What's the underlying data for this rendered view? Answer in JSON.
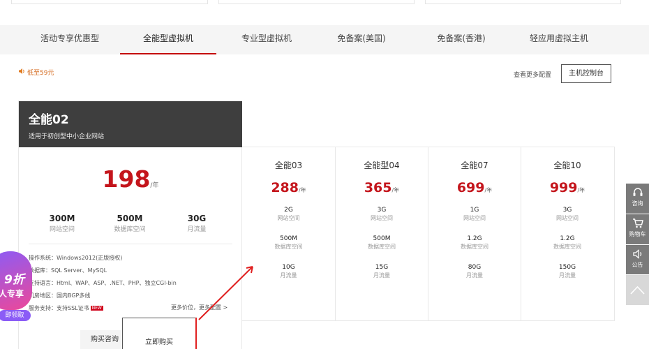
{
  "tabs": [
    {
      "label": "活动专享优惠型"
    },
    {
      "label": "全能型虚拟机"
    },
    {
      "label": "专业型虚拟机"
    },
    {
      "label": "免备案(美国)"
    },
    {
      "label": "免备案(香港)"
    },
    {
      "label": "轻应用虚拟主机"
    }
  ],
  "active_tab": "全能型虚拟机",
  "notice": {
    "text": "低至59元",
    "icon": "speaker-icon"
  },
  "more_config": "查看更多配置",
  "console_button": "主机控制台",
  "featured": {
    "title": "全能02",
    "subtitle": "适用于初创型中小企业网站",
    "price": "198",
    "unit": "/年",
    "specs": [
      {
        "value": "300M",
        "label": "网站空间"
      },
      {
        "value": "500M",
        "label": "数据库空间"
      },
      {
        "value": "30G",
        "label": "月流量"
      }
    ],
    "details": [
      "操作系统：Windows2012(正版授权)",
      "数据库：SQL Server、MySQL",
      "支持语言：Html、WAP、ASP、.NET、PHP、独立CGI-bin",
      "机房地区：国内BGP多线",
      "服务支持：支持SSL证书"
    ],
    "new_badge": "NEW",
    "more_price": "更多价位，更多配置 >",
    "consult_button": "购买咨询",
    "buy_button": "立即购买"
  },
  "plans": [
    {
      "name": "全能03",
      "price": "288",
      "unit": "/年",
      "specs": [
        {
          "value": "2G",
          "label": "网站空间"
        },
        {
          "value": "500M",
          "label": "数据库空间"
        },
        {
          "value": "10G",
          "label": "月流量"
        }
      ]
    },
    {
      "name": "全能型04",
      "price": "365",
      "unit": "/年",
      "specs": [
        {
          "value": "3G",
          "label": "网站空间"
        },
        {
          "value": "500M",
          "label": "数据库空间"
        },
        {
          "value": "15G",
          "label": "月流量"
        }
      ]
    },
    {
      "name": "全能07",
      "price": "699",
      "unit": "/年",
      "specs": [
        {
          "value": "1G",
          "label": "网站空间"
        },
        {
          "value": "1.2G",
          "label": "数据库空间"
        },
        {
          "value": "80G",
          "label": "月流量"
        }
      ]
    },
    {
      "name": "全能10",
      "price": "999",
      "unit": "/年",
      "specs": [
        {
          "value": "3G",
          "label": "网站空间"
        },
        {
          "value": "1.2G",
          "label": "数据库空间"
        },
        {
          "value": "150G",
          "label": "月流量"
        }
      ]
    }
  ],
  "float_bar": [
    {
      "label": "咨询",
      "icon": "headset-icon"
    },
    {
      "label": "购物车",
      "icon": "cart-icon"
    },
    {
      "label": "公告",
      "icon": "speaker-icon"
    }
  ],
  "promo": {
    "big": "9折",
    "line": "人专享",
    "button": "即领取"
  },
  "colors": {
    "price_red": "#c4151c",
    "header_dark": "#3e3e3e",
    "accent_tab": "#c40000",
    "annotation": "#e02020"
  }
}
